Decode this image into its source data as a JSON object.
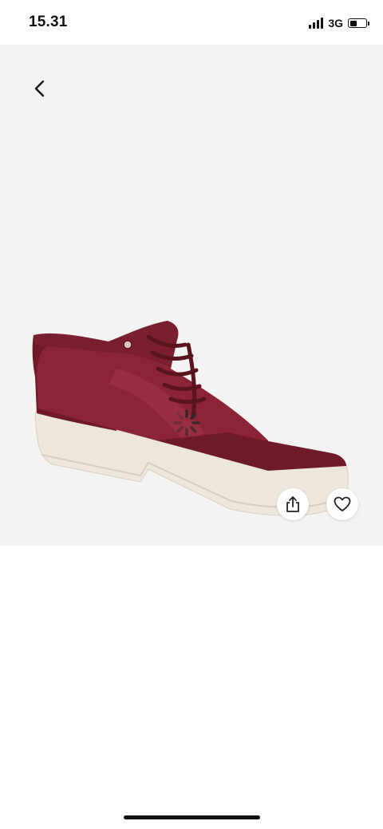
{
  "status_bar": {
    "time": "15.31",
    "network": "3G",
    "signal_bars": 4,
    "battery_level": 0.45
  },
  "product": {
    "image_icon": "burgundy-sneaker-image",
    "colors": {
      "upper": "#8a2436",
      "suede": "#6e1a28",
      "sole": "#ece6dc",
      "background": "#f3f3f3"
    }
  },
  "icons": {
    "back": "chevron-left-icon",
    "share": "share-icon",
    "favorite": "heart-icon",
    "loading": "loading-spinner-icon"
  }
}
